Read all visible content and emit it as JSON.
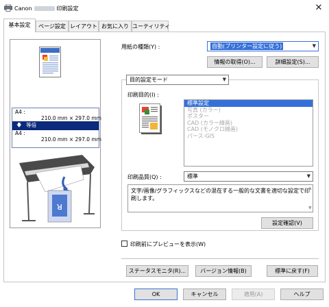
{
  "window": {
    "title_prefix": "Canon",
    "title_suffix": "印刷設定",
    "close_glyph": "✕"
  },
  "tabs": [
    "基本設定",
    "ページ設定",
    "レイアウト",
    "お気に入り",
    "ユーティリティ"
  ],
  "preview": {
    "input_label": "A4 :",
    "input_size": "210.0 mm × 297.0 mm",
    "scale_label": "等倍",
    "output_label": "A4 :",
    "output_size": "210.0 mm × 297.0 mm"
  },
  "media": {
    "label": "用紙の種類(Y) :",
    "value": "自動(プリンター設定に従う)",
    "get_info_button": "情報の取得(O)...",
    "detail_button": "詳細設定(S)..."
  },
  "mode": {
    "value": "目的設定モード"
  },
  "purpose": {
    "label": "印刷目的(I) :",
    "items": [
      "標準設定",
      "写真 (カラー)",
      "ポスター",
      "CAD (カラー線画)",
      "CAD (モノクロ線画)",
      "パース-GIS"
    ],
    "selected_index": 0
  },
  "quality": {
    "label": "印刷品質(Q) :",
    "value": "標準"
  },
  "description": {
    "text": "文字/画像/グラフィックスなどの混在する一般的な文書を適切な設定で印刷します。"
  },
  "confirm_button": "設定確認(V)",
  "preview_checkbox": {
    "label": "印刷前にプレビューを表示(W)",
    "checked": false
  },
  "bottom_buttons": {
    "status_monitor": "ステータスモニタ(R)...",
    "version_info": "バージョン情報(B)",
    "defaults": "標準に戻す(F)"
  },
  "dialog_buttons": {
    "ok": "OK",
    "cancel": "キャンセル",
    "apply": "適用(A)",
    "help": "ヘルプ"
  },
  "colors": {
    "selection": "#3470d9",
    "dark_selection": "#0b2a7c"
  }
}
